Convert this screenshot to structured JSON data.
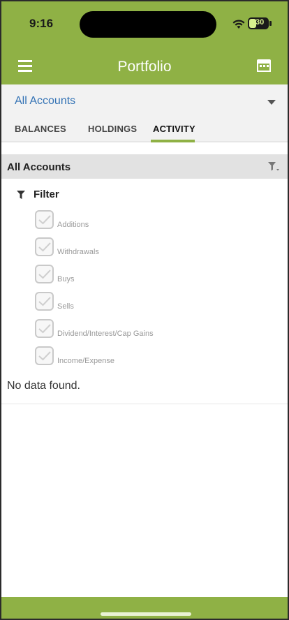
{
  "status_bar": {
    "time": "9:16",
    "battery_level": "30"
  },
  "app_bar": {
    "title": "Portfolio",
    "menu_icon": "hamburger-icon",
    "calendar_icon": "calendar-icon"
  },
  "account_selector": {
    "value": "All Accounts",
    "caret_icon": "caret-down-icon"
  },
  "tabs": [
    {
      "label": "BALANCES",
      "active": false
    },
    {
      "label": "HOLDINGS",
      "active": false
    },
    {
      "label": "ACTIVITY",
      "active": true
    }
  ],
  "section": {
    "title": "All Accounts",
    "filter_icon": "filter-dropdown-icon"
  },
  "filter": {
    "heading": "Filter",
    "options": [
      {
        "label": "Additions",
        "checked": true
      },
      {
        "label": "Withdrawals",
        "checked": true
      },
      {
        "label": "Buys",
        "checked": true
      },
      {
        "label": "Sells",
        "checked": true
      },
      {
        "label": "Dividend/Interest/Cap Gains",
        "checked": true
      },
      {
        "label": "Income/Expense",
        "checked": true
      }
    ]
  },
  "empty_state": {
    "message": "No data found."
  },
  "colors": {
    "brand_green": "#8fb145",
    "link_blue": "#3473b5"
  }
}
